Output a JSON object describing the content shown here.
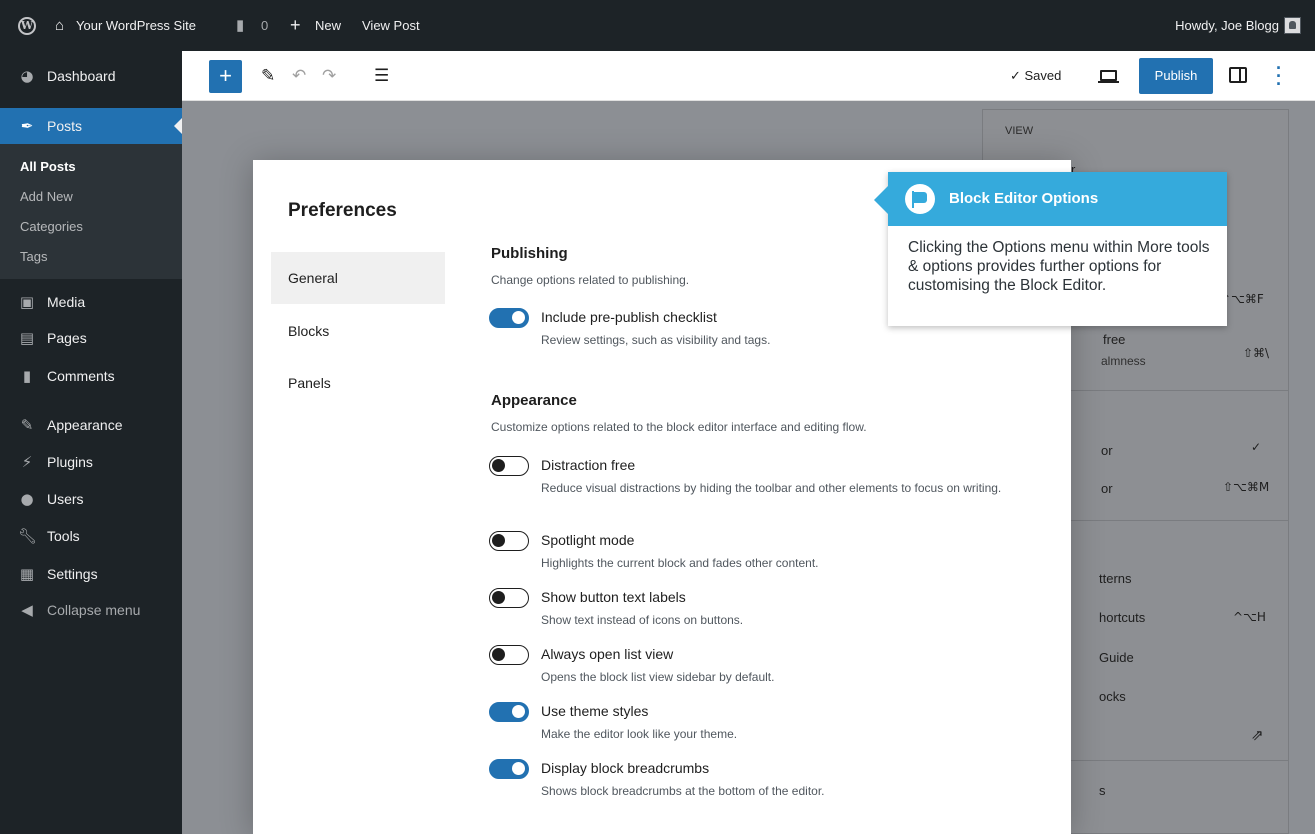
{
  "admin_bar": {
    "site_name": "Your WordPress Site",
    "comments_count": "0",
    "new_label": "New",
    "view_post_label": "View Post",
    "greeting": "Howdy, Joe Blogg"
  },
  "sidebar": {
    "items": [
      {
        "label": "Dashboard",
        "icon": "dashboard-icon"
      },
      {
        "label": "Posts",
        "icon": "pin-icon"
      },
      {
        "label": "Media",
        "icon": "media-icon"
      },
      {
        "label": "Pages",
        "icon": "pages-icon"
      },
      {
        "label": "Comments",
        "icon": "comment-icon"
      },
      {
        "label": "Appearance",
        "icon": "brush-icon"
      },
      {
        "label": "Plugins",
        "icon": "plug-icon"
      },
      {
        "label": "Users",
        "icon": "users-icon"
      },
      {
        "label": "Tools",
        "icon": "wrench-icon"
      },
      {
        "label": "Settings",
        "icon": "settings-icon"
      },
      {
        "label": "Collapse menu",
        "icon": "collapse-icon"
      }
    ],
    "posts_submenu": [
      "All Posts",
      "Add New",
      "Categories",
      "Tags"
    ]
  },
  "editor_toolbar": {
    "saved_label": "✓ Saved",
    "publish_label": "Publish"
  },
  "options_dropdown": {
    "view_heading": "VIEW",
    "partial_items": [
      "r",
      "free",
      "almness",
      "or",
      "or",
      "tterns",
      "hortcuts",
      "Guide",
      "ocks",
      "s"
    ],
    "shortcuts": [
      "⌃⌥⌘F",
      "⇧⌘\\",
      "✓",
      "⇧⌥⌘M",
      "^⌥H",
      "⇗"
    ]
  },
  "preferences": {
    "title": "Preferences",
    "tabs": [
      "General",
      "Blocks",
      "Panels"
    ],
    "active_tab": "General",
    "sections": [
      {
        "title": "Publishing",
        "description": "Change options related to publishing.",
        "options": [
          {
            "label": "Include pre-publish checklist",
            "help": "Review settings, such as visibility and tags.",
            "enabled": true
          }
        ]
      },
      {
        "title": "Appearance",
        "description": "Customize options related to the block editor interface and editing flow.",
        "options": [
          {
            "label": "Distraction free",
            "help": "Reduce visual distractions by hiding the toolbar and other elements to focus on writing.",
            "enabled": false
          },
          {
            "label": "Spotlight mode",
            "help": "Highlights the current block and fades other content.",
            "enabled": false
          },
          {
            "label": "Show button text labels",
            "help": "Show text instead of icons on buttons.",
            "enabled": false
          },
          {
            "label": "Always open list view",
            "help": "Opens the block list view sidebar by default.",
            "enabled": false
          },
          {
            "label": "Use theme styles",
            "help": "Make the editor look like your theme.",
            "enabled": true
          },
          {
            "label": "Display block breadcrumbs",
            "help": "Shows block breadcrumbs at the bottom of the editor.",
            "enabled": true
          }
        ]
      }
    ]
  },
  "callout": {
    "title": "Block Editor Options",
    "body": "Clicking the Options menu within More tools & options provides further options for customising the Block Editor."
  },
  "colors": {
    "admin_dark": "#1d2327",
    "wp_blue": "#2271b1",
    "callout_blue": "#35aadc"
  }
}
